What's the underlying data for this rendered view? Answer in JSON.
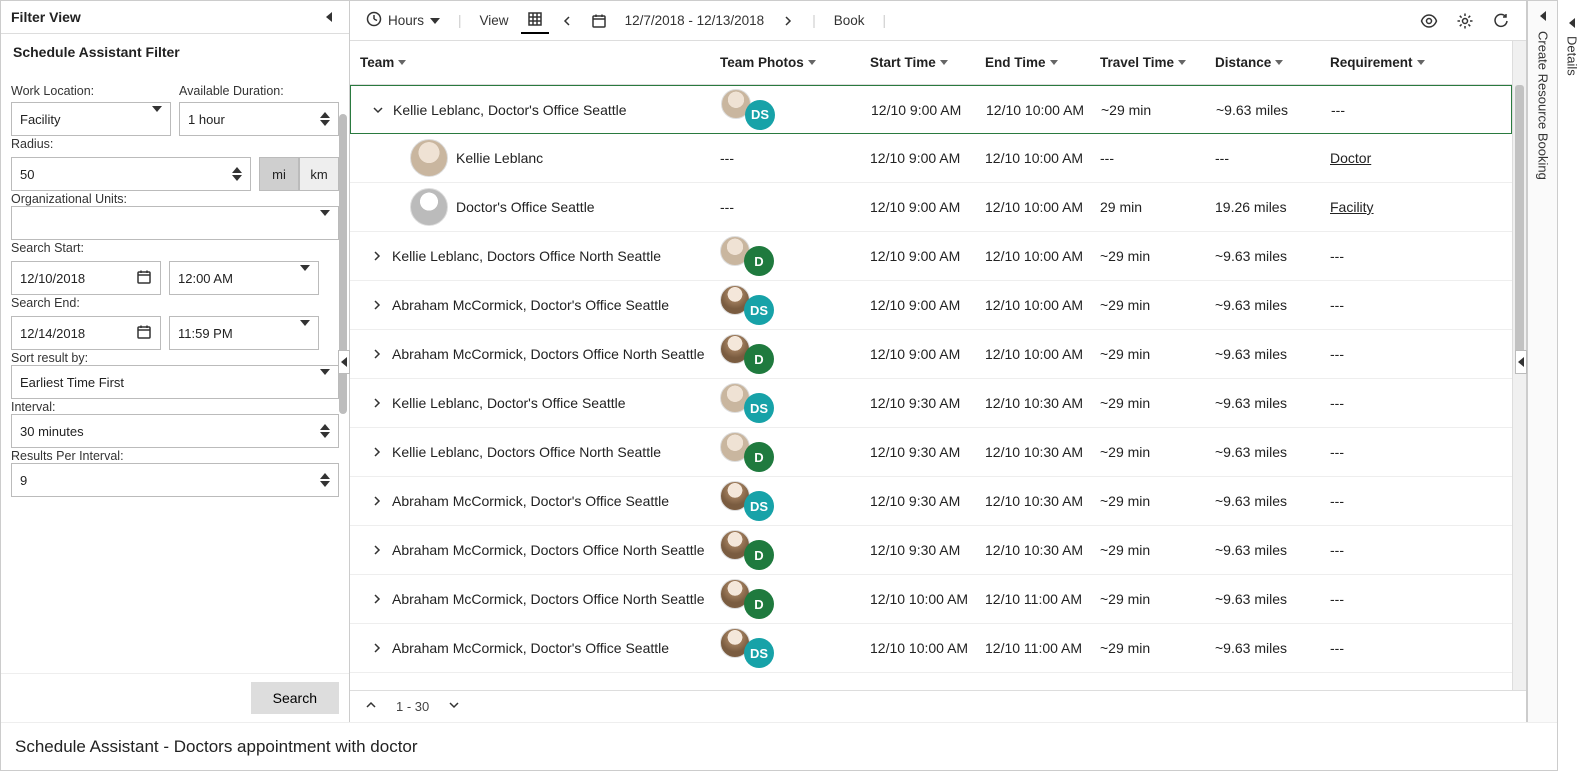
{
  "footer_title": "Schedule Assistant - Doctors appointment with doctor",
  "filter": {
    "panel_title": "Filter View",
    "section_title": "Schedule Assistant Filter",
    "work_location_label": "Work Location:",
    "work_location_value": "Facility",
    "available_duration_label": "Available Duration:",
    "available_duration_value": "1 hour",
    "radius_label": "Radius:",
    "radius_value": "50",
    "unit_mi": "mi",
    "unit_km": "km",
    "org_units_label": "Organizational Units:",
    "org_units_value": "",
    "search_start_label": "Search Start:",
    "search_start_date": "12/10/2018",
    "search_start_time": "12:00 AM",
    "search_end_label": "Search End:",
    "search_end_date": "12/14/2018",
    "search_end_time": "11:59 PM",
    "sort_label": "Sort result by:",
    "sort_value": "Earliest Time First",
    "interval_label": "Interval:",
    "interval_value": "30 minutes",
    "results_per_interval_label": "Results Per Interval:",
    "results_per_interval_value": "9",
    "search_button": "Search"
  },
  "toolbar": {
    "hours_label": "Hours",
    "view_label": "View",
    "date_range": "12/7/2018 - 12/13/2018",
    "book_label": "Book"
  },
  "columns": {
    "team": "Team",
    "photos": "Team Photos",
    "start": "Start Time",
    "end": "End Time",
    "travel": "Travel Time",
    "distance": "Distance",
    "requirement": "Requirement"
  },
  "rows": [
    {
      "type": "parent",
      "expanded": true,
      "selected": true,
      "team": "Kellie Leblanc, Doctor's Office Seattle",
      "avatar": "kellie",
      "badge": "DS",
      "badgeClass": "ds",
      "start": "12/10 9:00 AM",
      "end": "12/10 10:00 AM",
      "travel": "~29 min",
      "distance": "~9.63 miles",
      "req": "---"
    },
    {
      "type": "child",
      "team": "Kellie Leblanc",
      "avatar": "kellie",
      "child_photos": "---",
      "start": "12/10 9:00 AM",
      "end": "12/10 10:00 AM",
      "travel": "---",
      "distance": "---",
      "req": "Doctor",
      "req_link": true
    },
    {
      "type": "child",
      "team": "Doctor's Office Seattle",
      "avatar": "generic",
      "child_photos": "---",
      "start": "12/10 9:00 AM",
      "end": "12/10 10:00 AM",
      "travel": "29 min",
      "distance": "19.26 miles",
      "req": "Facility",
      "req_link": true
    },
    {
      "type": "parent",
      "team": "Kellie Leblanc, Doctors Office North Seattle",
      "avatar": "kellie",
      "badge": "D",
      "badgeClass": "d",
      "start": "12/10 9:00 AM",
      "end": "12/10 10:00 AM",
      "travel": "~29 min",
      "distance": "~9.63 miles",
      "req": "---"
    },
    {
      "type": "parent",
      "team": "Abraham McCormick, Doctor's Office Seattle",
      "avatar": "abraham",
      "badge": "DS",
      "badgeClass": "ds",
      "start": "12/10 9:00 AM",
      "end": "12/10 10:00 AM",
      "travel": "~29 min",
      "distance": "~9.63 miles",
      "req": "---"
    },
    {
      "type": "parent",
      "team": "Abraham McCormick, Doctors Office North Seattle",
      "avatar": "abraham",
      "badge": "D",
      "badgeClass": "d",
      "start": "12/10 9:00 AM",
      "end": "12/10 10:00 AM",
      "travel": "~29 min",
      "distance": "~9.63 miles",
      "req": "---"
    },
    {
      "type": "parent",
      "team": "Kellie Leblanc, Doctor's Office Seattle",
      "avatar": "kellie",
      "badge": "DS",
      "badgeClass": "ds",
      "start": "12/10 9:30 AM",
      "end": "12/10 10:30 AM",
      "travel": "~29 min",
      "distance": "~9.63 miles",
      "req": "---"
    },
    {
      "type": "parent",
      "team": "Kellie Leblanc, Doctors Office North Seattle",
      "avatar": "kellie",
      "badge": "D",
      "badgeClass": "d",
      "start": "12/10 9:30 AM",
      "end": "12/10 10:30 AM",
      "travel": "~29 min",
      "distance": "~9.63 miles",
      "req": "---"
    },
    {
      "type": "parent",
      "team": "Abraham McCormick, Doctor's Office Seattle",
      "avatar": "abraham",
      "badge": "DS",
      "badgeClass": "ds",
      "start": "12/10 9:30 AM",
      "end": "12/10 10:30 AM",
      "travel": "~29 min",
      "distance": "~9.63 miles",
      "req": "---"
    },
    {
      "type": "parent",
      "team": "Abraham McCormick, Doctors Office North Seattle",
      "avatar": "abraham",
      "badge": "D",
      "badgeClass": "d",
      "start": "12/10 9:30 AM",
      "end": "12/10 10:30 AM",
      "travel": "~29 min",
      "distance": "~9.63 miles",
      "req": "---"
    },
    {
      "type": "parent",
      "team": "Abraham McCormick, Doctors Office North Seattle",
      "avatar": "abraham",
      "badge": "D",
      "badgeClass": "d",
      "start": "12/10 10:00 AM",
      "end": "12/10 11:00 AM",
      "travel": "~29 min",
      "distance": "~9.63 miles",
      "req": "---"
    },
    {
      "type": "parent",
      "team": "Abraham McCormick, Doctor's Office Seattle",
      "avatar": "abraham",
      "badge": "DS",
      "badgeClass": "ds",
      "start": "12/10 10:00 AM",
      "end": "12/10 11:00 AM",
      "travel": "~29 min",
      "distance": "~9.63 miles",
      "req": "---"
    }
  ],
  "results_footer": {
    "range": "1 - 30"
  },
  "right_rail": {
    "create_booking": "Create Resource Booking"
  },
  "details_rail": {
    "details": "Details"
  }
}
